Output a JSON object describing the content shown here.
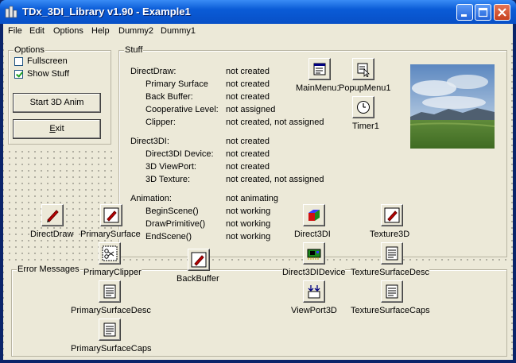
{
  "window": {
    "title": "TDx_3DI_Library v1.90 - Example1"
  },
  "menu": [
    "File",
    "Edit",
    "Options",
    "Help",
    "Dummy2",
    "Dummy1"
  ],
  "options": {
    "title": "Options",
    "fullscreen_label": "Fullscreen",
    "fullscreen_checked": false,
    "show_stuff_label": "Show Stuff",
    "show_stuff_checked": true,
    "start_label": "Start 3D Anim",
    "exit_label": "Exit"
  },
  "stuff": {
    "title": "Stuff",
    "rows": [
      {
        "label": "DirectDraw:",
        "value": "not created"
      },
      {
        "label": "Primary Surface",
        "value": "not created"
      },
      {
        "label": "Back Buffer:",
        "value": "not created"
      },
      {
        "label": "Cooperative Level:",
        "value": "not assigned"
      },
      {
        "label": "Clipper:",
        "value": "not created, not assigned"
      },
      {
        "label": "Direct3DI:",
        "value": "not created"
      },
      {
        "label": "Direct3DI Device:",
        "value": "not created"
      },
      {
        "label": "3D ViewPort:",
        "value": "not created"
      },
      {
        "label": "3D Texture:",
        "value": "not created, not assigned"
      },
      {
        "label": "Animation:",
        "value": "not animating"
      },
      {
        "label": "BeginScene()",
        "value": "not working"
      },
      {
        "label": "DrawPrimitive()",
        "value": "not working"
      },
      {
        "label": "EndScene()",
        "value": "not working"
      }
    ]
  },
  "error_messages": {
    "title": "Error Messages"
  },
  "components": {
    "main_menu": "MainMenu1",
    "popup_menu": "PopupMenu1",
    "timer": "Timer1",
    "direct_draw": "DirectDraw",
    "primary_surface": "PrimarySurface",
    "direct3d": "Direct3DI",
    "texture3d": "Texture3D",
    "primary_clipper": "PrimaryClipper",
    "back_buffer": "BackBuffer",
    "direct3d_device": "Direct3DIDevice",
    "texture_surface_desc": "TextureSurfaceDesc",
    "primary_surface_desc": "PrimarySurfaceDesc",
    "viewport3d": "ViewPort3D",
    "texture_surface_caps": "TextureSurfaceCaps",
    "primary_surface_caps": "PrimarySurfaceCaps"
  }
}
